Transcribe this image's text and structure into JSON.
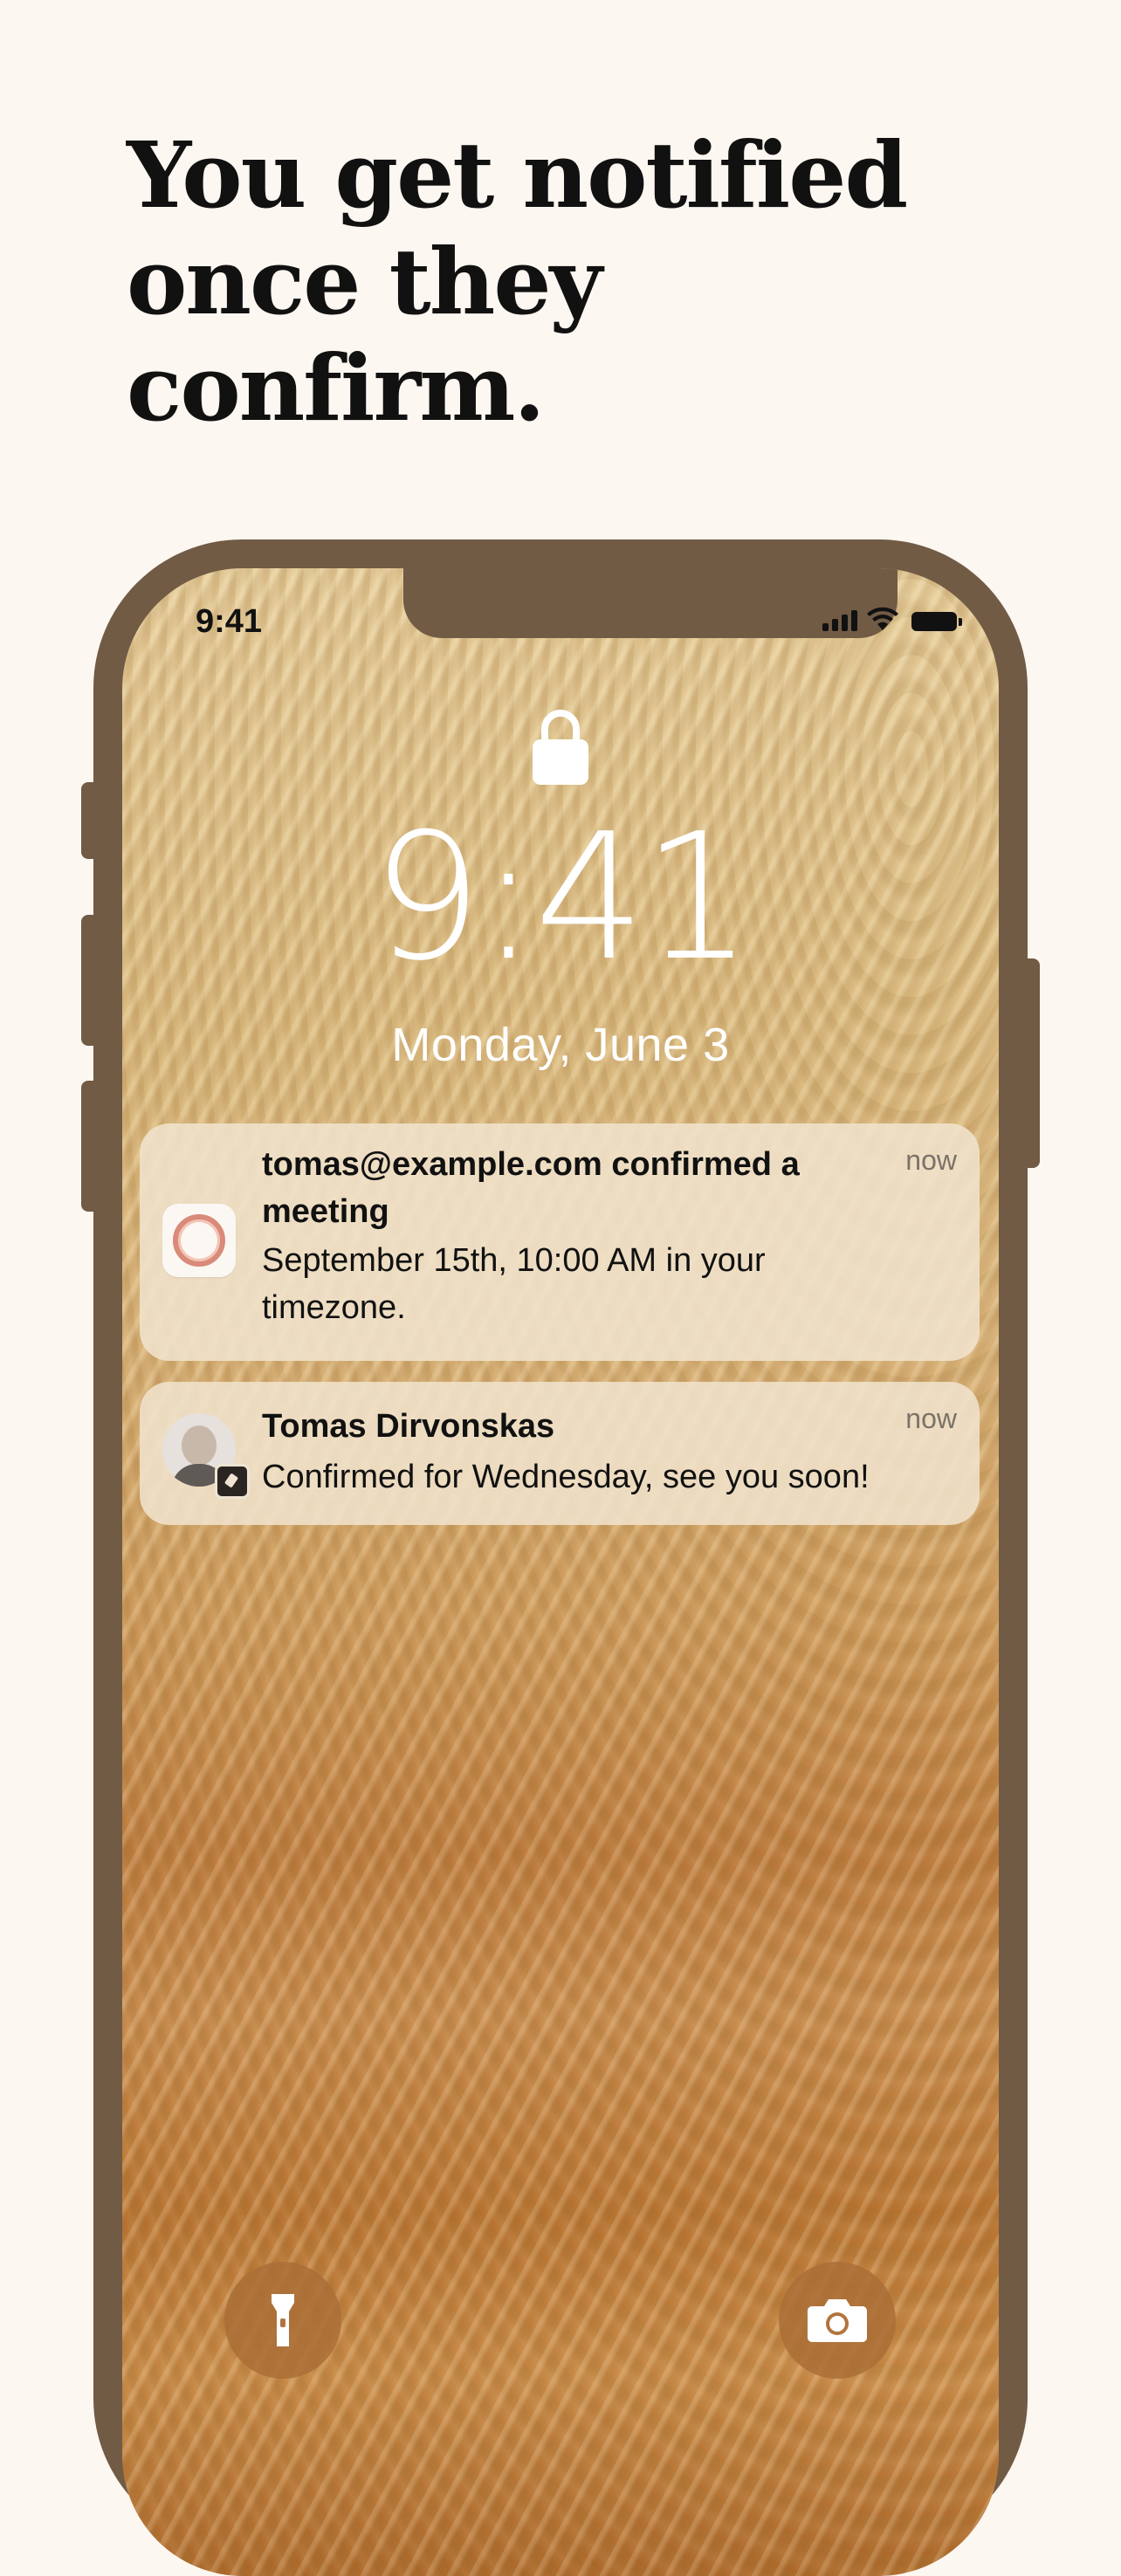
{
  "headline": {
    "line1": "You get notified",
    "line2": "once they confirm."
  },
  "phone": {
    "status_bar": {
      "time": "9:41",
      "icons": [
        "cellular-signal-icon",
        "wifi-icon",
        "battery-icon"
      ]
    },
    "lock_screen": {
      "lock_icon": "lock-icon",
      "time": "9:41",
      "date": "Monday, June 3"
    },
    "notifications": [
      {
        "app_icon": "meeting-app-icon",
        "title": "tomas@example.com confirmed a meeting",
        "body": "September 15th, 10:00 AM in your timezone.",
        "time": "now"
      },
      {
        "app_icon": "contact-avatar",
        "title": "Tomas Dirvonskas",
        "body": "Confirmed for Wednesday, see you soon!",
        "time": "now"
      }
    ],
    "quick_actions": [
      "flashlight-icon",
      "camera-icon"
    ]
  },
  "colors": {
    "background": "#fdf7f1",
    "phone_frame": "#715b45",
    "notification_bg": "#f0e2cc"
  }
}
